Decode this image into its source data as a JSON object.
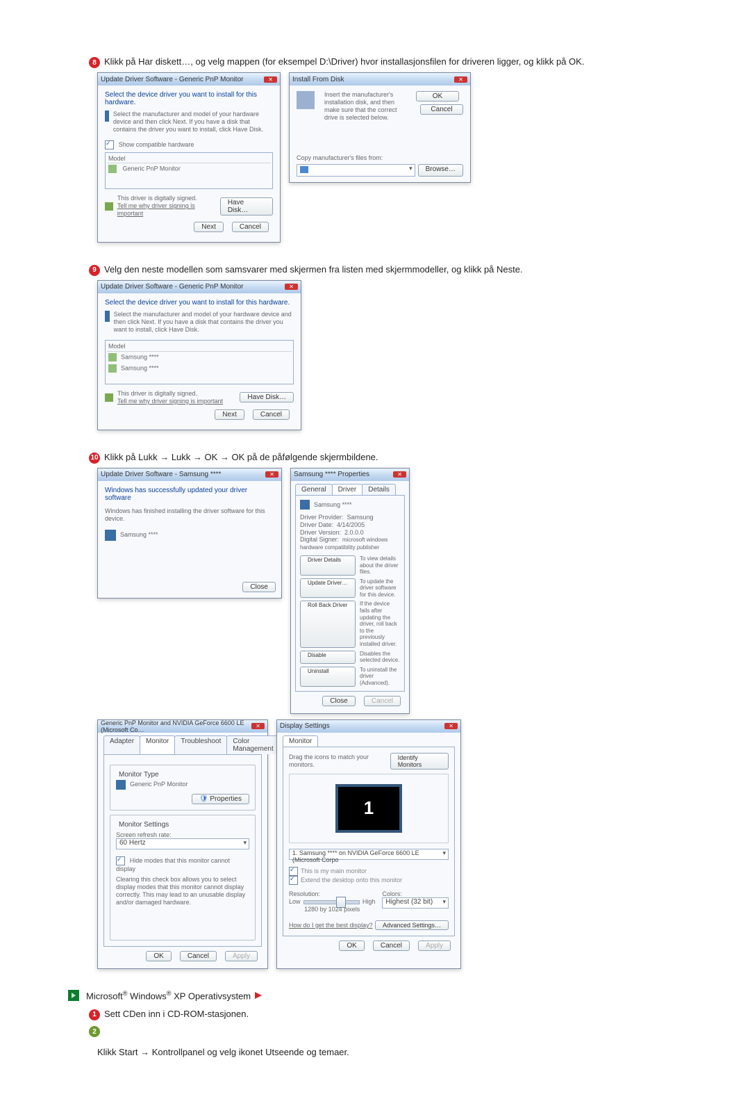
{
  "step8": {
    "num": "8",
    "text": "Klikk på Har diskett…, og velg mappen (for eksempel D:\\Driver) hvor installasjonsfilen for driveren ligger, og klikk på OK."
  },
  "win1": {
    "title": "Update Driver Software - Generic PnP Monitor",
    "heading": "Select the device driver you want to install for this hardware.",
    "sub": "Select the manufacturer and model of your hardware device and then click Next. If you have a disk that contains the driver you want to install, click Have Disk.",
    "showcompat": "Show compatible hardware",
    "model_label": "Model",
    "model_item": "Generic PnP Monitor",
    "signed": "This driver is digitally signed.",
    "tellme": "Tell me why driver signing is important",
    "havedisk": "Have Disk…",
    "next": "Next",
    "cancel": "Cancel"
  },
  "win2": {
    "title": "Install From Disk",
    "msg": "Insert the manufacturer's installation disk, and then make sure that the correct drive is selected below.",
    "ok": "OK",
    "cancel": "Cancel",
    "copyfrom": "Copy manufacturer's files from:",
    "browse": "Browse…"
  },
  "step9": {
    "num": "9",
    "text": "Velg den neste modellen som samsvarer med skjermen fra listen med skjermmodeller, og klikk på Neste."
  },
  "win3": {
    "title": "Update Driver Software - Generic PnP Monitor",
    "heading": "Select the device driver you want to install for this hardware.",
    "sub": "Select the manufacturer and model of your hardware device and then click Next. If you have a disk that contains the driver you want to install, click Have Disk.",
    "model_label": "Model",
    "m1": "Samsung ****",
    "m2": "Samsung ****",
    "signed": "This driver is digitally signed.",
    "tellme": "Tell me why driver signing is important",
    "havedisk": "Have Disk…",
    "next": "Next",
    "cancel": "Cancel"
  },
  "step10": {
    "num": "10",
    "text": "Klikk på Lukk → Lukk → OK → OK på de påfølgende skjermbildene."
  },
  "win4": {
    "title": "Update Driver Software - Samsung ****",
    "heading": "Windows has successfully updated your driver software",
    "sub": "Windows has finished installing the driver software for this device.",
    "device": "Samsung ****",
    "close": "Close"
  },
  "win5": {
    "title": "Samsung **** Properties",
    "tabs": {
      "general": "General",
      "driver": "Driver",
      "details": "Details"
    },
    "device": "Samsung ****",
    "rows": {
      "prov_l": "Driver Provider:",
      "prov_v": "Samsung",
      "date_l": "Driver Date:",
      "date_v": "4/14/2005",
      "ver_l": "Driver Version:",
      "ver_v": "2.0.0.0",
      "sig_l": "Digital Signer:",
      "sig_v": "microsoft windows hardware compatibility publisher"
    },
    "b1": {
      "l": "Driver Details",
      "d": "To view details about the driver files."
    },
    "b2": {
      "l": "Update Driver…",
      "d": "To update the driver software for this device."
    },
    "b3": {
      "l": "Roll Back Driver",
      "d": "If the device fails after updating the driver, roll back to the previously installed driver."
    },
    "b4": {
      "l": "Disable",
      "d": "Disables the selected device."
    },
    "b5": {
      "l": "Uninstall",
      "d": "To uninstall the driver (Advanced)."
    },
    "close": "Close",
    "cancel": "Cancel"
  },
  "win6": {
    "title": "Generic PnP Monitor and NVIDIA GeForce 6600 LE (Microsoft Co…",
    "tabs": {
      "adapter": "Adapter",
      "monitor": "Monitor",
      "troubleshoot": "Troubleshoot",
      "color": "Color Management"
    },
    "montype_legend": "Monitor Type",
    "montype_val": "Generic PnP Monitor",
    "properties": "Properties",
    "monset_legend": "Monitor Settings",
    "refresh_l": "Screen refresh rate:",
    "refresh_v": "60 Hertz",
    "hide": "Hide modes that this monitor cannot display",
    "hide_desc": "Clearing this check box allows you to select display modes that this monitor cannot display correctly. This may lead to an unusable display and/or damaged hardware.",
    "ok": "OK",
    "cancel": "Cancel",
    "apply": "Apply"
  },
  "win7": {
    "title": "Display Settings",
    "tab": "Monitor",
    "drag": "Drag the icons to match your monitors.",
    "identify": "Identify Monitors",
    "mon_num": "1",
    "display_sel": "1. Samsung **** on NVIDIA GeForce 6600 LE (Microsoft Corpo",
    "main": "This is my main monitor",
    "extend": "Extend the desktop onto this monitor",
    "res_l": "Resolution:",
    "low": "Low",
    "high": "High",
    "res_v": "1280 by 1024 pixels",
    "col_l": "Colors:",
    "col_v": "Highest (32 bit)",
    "best": "How do I get the best display?",
    "adv": "Advanced Settings…",
    "ok": "OK",
    "cancel": "Cancel",
    "apply": "Apply"
  },
  "xp": {
    "label": "Microsoft® Windows® XP Operativsystem"
  },
  "step_xp1": {
    "num": "1",
    "text": "Sett CDen inn i CD-ROM-stasjonen."
  },
  "step_xp2": {
    "num": "2",
    "text": ""
  },
  "step_xp_line": "Klikk Start → Kontrollpanel og velg ikonet Utseende og temaer."
}
